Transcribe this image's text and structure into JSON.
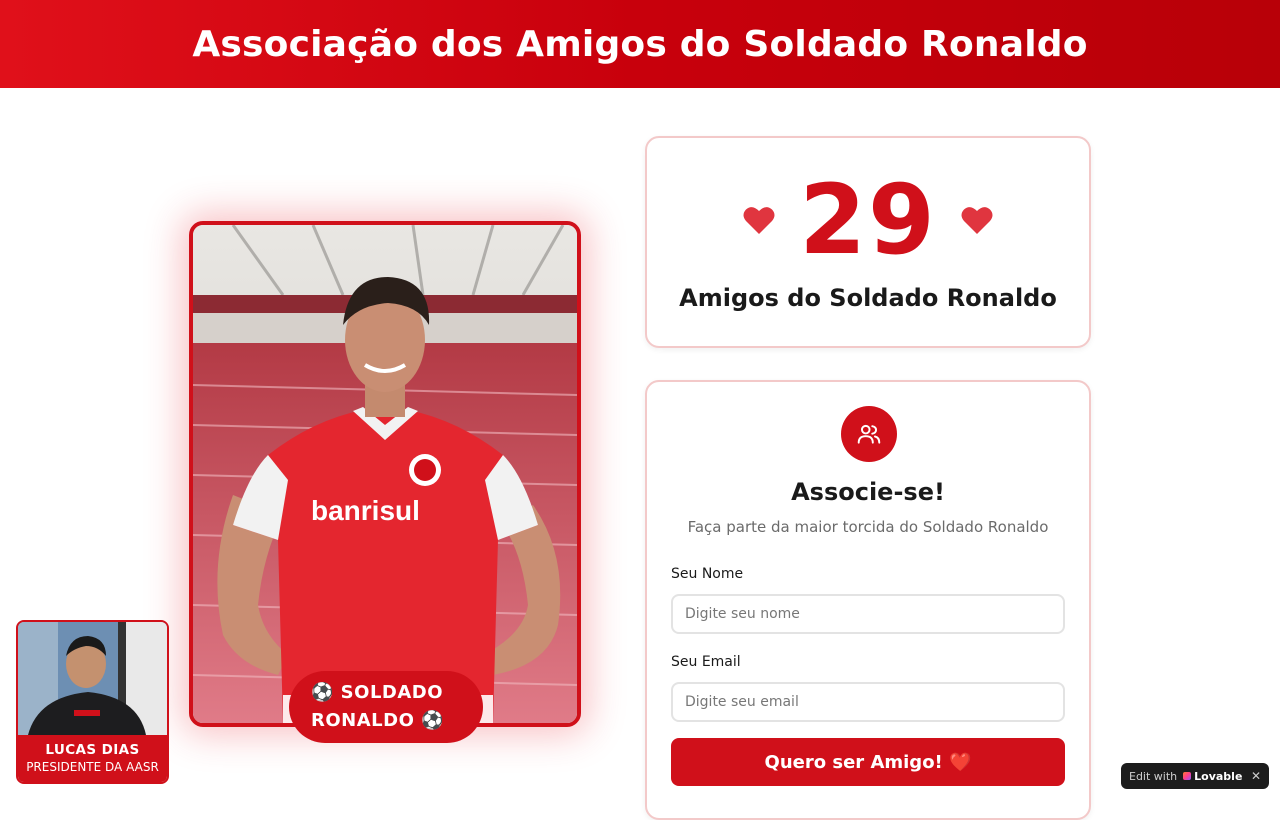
{
  "header": {
    "title": "Associação dos Amigos do Soldado Ronaldo"
  },
  "hero": {
    "badge_line1": "⚽ SOLDADO",
    "badge_line2": "RONALDO ⚽",
    "jersey_sponsor": "banrisul"
  },
  "president": {
    "name": "LUCAS DIAS",
    "title": "PRESIDENTE DA AASR"
  },
  "counter": {
    "value": "29",
    "label": "Amigos do Soldado Ronaldo"
  },
  "signup": {
    "title": "Associe-se!",
    "subtitle": "Faça parte da maior torcida do Soldado Ronaldo",
    "name_label": "Seu Nome",
    "name_placeholder": "Digite seu nome",
    "email_label": "Seu Email",
    "email_placeholder": "Digite seu email",
    "submit_label": "Quero ser Amigo! ❤️"
  },
  "lovable": {
    "prefix": "Edit with",
    "brand": "Lovable",
    "close": "✕"
  },
  "colors": {
    "primary_red": "#d0101a",
    "card_border": "#f3c9c9",
    "heart": "#e0353f"
  },
  "icons": {
    "counter_icons": "heart-icon",
    "signup_icon": "users-icon"
  }
}
